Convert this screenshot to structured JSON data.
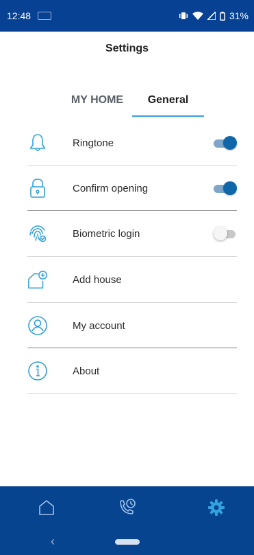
{
  "status_bar": {
    "time": "12:48",
    "battery": "31%"
  },
  "header": {
    "title": "Settings"
  },
  "tabs": [
    {
      "label": "MY HOME",
      "active": false
    },
    {
      "label": "General",
      "active": true
    }
  ],
  "settings": [
    {
      "label": "Ringtone",
      "icon": "bell-icon",
      "toggle": true,
      "on": true
    },
    {
      "label": "Confirm opening",
      "icon": "lock-icon",
      "toggle": true,
      "on": true
    },
    {
      "label": "Biometric login",
      "icon": "fingerprint-icon",
      "toggle": true,
      "on": false
    },
    {
      "label": "Add house",
      "icon": "add-house-icon",
      "toggle": false
    },
    {
      "label": "My account",
      "icon": "account-icon",
      "toggle": false
    },
    {
      "label": "About",
      "icon": "info-icon",
      "toggle": false
    }
  ],
  "bottom_nav": [
    {
      "name": "home",
      "icon": "home-icon"
    },
    {
      "name": "calls",
      "icon": "phone-clock-icon"
    },
    {
      "name": "settings",
      "icon": "gear-icon",
      "active": true
    }
  ],
  "colors": {
    "accent": "#33a2e0",
    "nav_bg": "#07448f",
    "toggle_on": "#0f66a8"
  }
}
